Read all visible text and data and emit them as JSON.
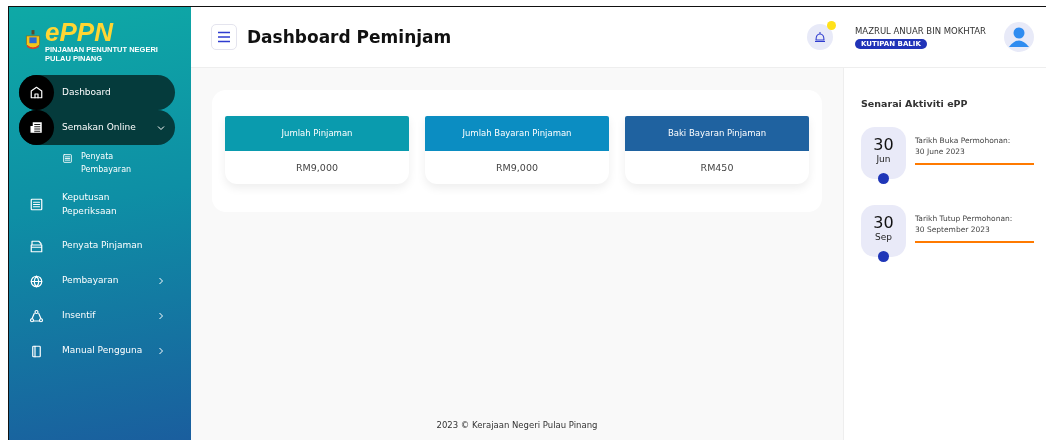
{
  "sidebar": {
    "logo": {
      "text": "ePPN",
      "tagline": "PINJAMAN PENUNTUT NEGERI PULAU PINANG"
    },
    "items": [
      {
        "label": "Dashboard",
        "kind": "link",
        "selected": true
      },
      {
        "label": "Semakan Online",
        "kind": "menu",
        "selected": true,
        "expanded": true,
        "children": [
          {
            "label": "Penyata Pembayaran",
            "selected": false
          }
        ]
      },
      {
        "label": "Keputusan Peperiksaan",
        "kind": "link",
        "selected": false
      },
      {
        "label": "Penyata Pinjaman",
        "kind": "link",
        "selected": false
      },
      {
        "label": "Pembayaran",
        "kind": "menu",
        "selected": false,
        "expanded": false
      },
      {
        "label": "Insentif",
        "kind": "menu",
        "selected": false,
        "expanded": false
      },
      {
        "label": "Manual Pengguna",
        "kind": "menu",
        "selected": false,
        "expanded": false
      }
    ]
  },
  "header": {
    "title": "Dashboard Peminjam",
    "notification": true,
    "user": {
      "name": "MAZRUL ANUAR BIN MOKHTAR",
      "role": "KUTIPAN BALIK"
    }
  },
  "summary_cards": [
    {
      "title": "Jumlah Pinjaman",
      "value": "RM9,000",
      "color": "#0a9bae"
    },
    {
      "title": "Jumlah Bayaran Pinjaman",
      "value": "RM9,000",
      "color": "#0b8dc2"
    },
    {
      "title": "Baki Bayaran Pinjaman",
      "value": "RM450",
      "color": "#1f62a0"
    }
  ],
  "activities": {
    "title": "Senarai Aktiviti ePP",
    "items": [
      {
        "day": "30",
        "month": "Jun",
        "label": "Tarikh Buka Permohonan:",
        "date": "30 June 2023"
      },
      {
        "day": "30",
        "month": "Sep",
        "label": "Tarikh Tutup Permohonan:",
        "date": "30 September 2023"
      }
    ]
  },
  "footer": "2023 © Kerajaan Negeri Pulau Pinang"
}
